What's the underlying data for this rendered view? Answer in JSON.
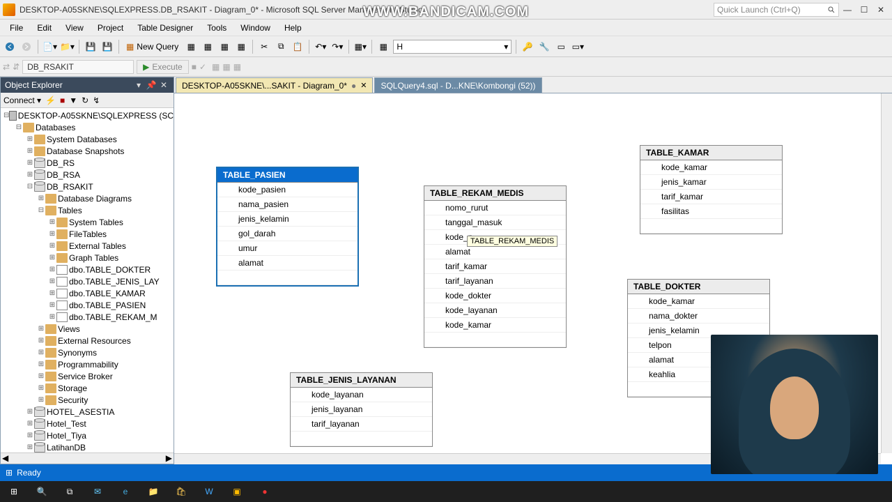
{
  "title": "DESKTOP-A05SKNE\\SQLEXPRESS.DB_RSAKIT - Diagram_0* - Microsoft SQL Server Management Studio",
  "watermark": "WWW.BANDICAM.COM",
  "quicklaunch_placeholder": "Quick Launch (Ctrl+Q)",
  "menu": [
    "File",
    "Edit",
    "View",
    "Project",
    "Table Designer",
    "Tools",
    "Window",
    "Help"
  ],
  "newquery_label": "New Query",
  "table_combo": "H",
  "db_context": "DB_RSAKIT",
  "execute_label": "Execute",
  "panel_title": "Object Explorer",
  "connect_label": "Connect",
  "tree_root": "DESKTOP-A05SKNE\\SQLEXPRESS (SC",
  "tree_databases": "Databases",
  "tree_folders": [
    "System Databases",
    "Database Snapshots"
  ],
  "tree_dbs": [
    "DB_RS",
    "DB_RSA"
  ],
  "tree_active_db": "DB_RSAKIT",
  "tree_active_children": [
    "Database Diagrams",
    "Tables"
  ],
  "tree_table_folders": [
    "System Tables",
    "FileTables",
    "External Tables",
    "Graph Tables"
  ],
  "tree_tables": [
    "dbo.TABLE_DOKTER",
    "dbo.TABLE_JENIS_LAY",
    "dbo.TABLE_KAMAR",
    "dbo.TABLE_PASIEN",
    "dbo.TABLE_REKAM_M"
  ],
  "tree_after_tables": [
    "Views",
    "External Resources",
    "Synonyms",
    "Programmability",
    "Service Broker",
    "Storage",
    "Security"
  ],
  "tree_other_dbs": [
    "HOTEL_ASESTIA",
    "Hotel_Test",
    "Hotel_Tiya",
    "LatihanDB"
  ],
  "tabs": [
    {
      "label": "DESKTOP-A05SKNE\\...SAKIT - Diagram_0*",
      "active": true,
      "dirty": true
    },
    {
      "label": "SQLQuery4.sql - D...KNE\\Kombongi (52))",
      "active": false,
      "dirty": false
    }
  ],
  "diagram_tables": {
    "pasien": {
      "title": "TABLE_PASIEN",
      "cols": [
        "kode_pasien",
        "nama_pasien",
        "jenis_kelamin",
        "gol_darah",
        "umur",
        "alamat"
      ]
    },
    "rekam": {
      "title": "TABLE_REKAM_MEDIS",
      "cols": [
        "nomo_rurut",
        "tanggal_masuk",
        "kode_p",
        "alamat",
        "tarif_kamar",
        "tarif_layanan",
        "kode_dokter",
        "kode_layanan",
        "kode_kamar"
      ],
      "tooltip": "TABLE_REKAM_MEDIS"
    },
    "kamar": {
      "title": "TABLE_KAMAR",
      "cols": [
        "kode_kamar",
        "jenis_kamar",
        "tarif_kamar",
        "fasilitas"
      ]
    },
    "dokter": {
      "title": "TABLE_DOKTER",
      "cols": [
        "kode_kamar",
        "nama_dokter",
        "jenis_kelamin",
        "telpon",
        "alamat",
        "keahlia"
      ]
    },
    "layanan": {
      "title": "TABLE_JENIS_LAYANAN",
      "cols": [
        "kode_layanan",
        "jenis_layanan",
        "tarif_layanan"
      ]
    }
  },
  "status": "Ready"
}
